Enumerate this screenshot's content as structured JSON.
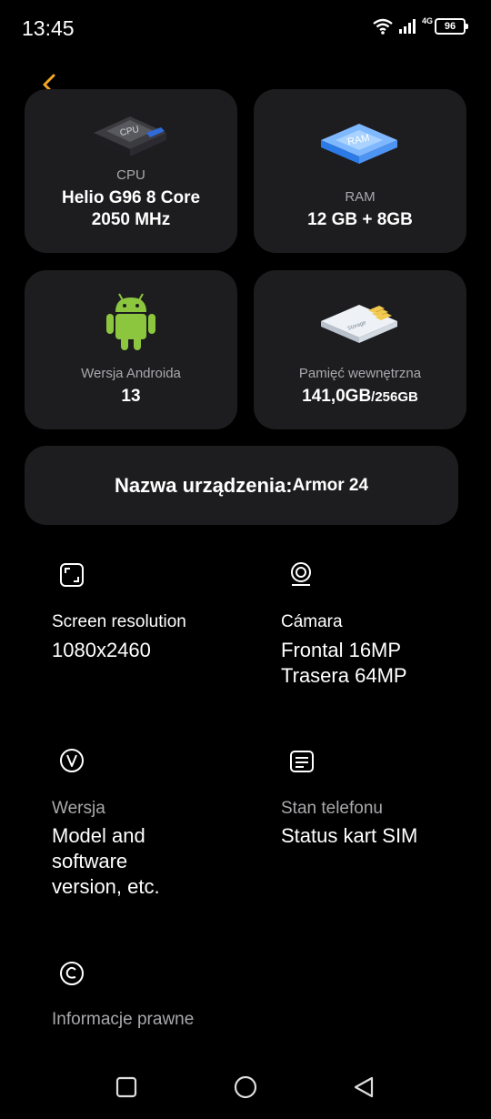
{
  "status_bar": {
    "time": "13:45",
    "network": "4G",
    "battery": "96",
    "icons": [
      "wifi-icon",
      "signal-icon",
      "battery-icon"
    ]
  },
  "header": {
    "back_icon": "chevron-left-icon",
    "accent_color": "#f5a623"
  },
  "cards": {
    "cpu": {
      "label": "CPU",
      "value_line1": "Helio G96 8 Core",
      "value_line2": "2050 MHz",
      "icon": "cpu-chip-icon"
    },
    "ram": {
      "label": "RAM",
      "value": "12 GB + 8GB",
      "icon": "ram-chip-icon"
    },
    "android": {
      "label": "Wersja Androida",
      "value": "13",
      "icon": "android-robot-icon"
    },
    "storage": {
      "label": "Pamięć wewnętrzna",
      "value_used": "141,0GB",
      "value_total": "/256GB",
      "icon": "memory-card-icon"
    }
  },
  "device": {
    "label": "Nazwa urządzenia:",
    "value": "Armor 24"
  },
  "info": {
    "screen": {
      "title": "Screen resolution",
      "value": "1080x2460",
      "icon": "screen-resolution-icon"
    },
    "camera": {
      "title": "Cámara",
      "value_line1": "Frontal 16MP",
      "value_line2": "Trasera 64MP",
      "icon": "camera-icon"
    },
    "version": {
      "title": "Wersja",
      "value_line1": "Model and",
      "value_line2": "software",
      "value_line3": "version, etc.",
      "icon": "version-icon"
    },
    "phone_status": {
      "title": "Stan telefonu",
      "value": "Status kart SIM",
      "icon": "sim-status-icon"
    },
    "legal": {
      "title": "Informacje prawne",
      "icon": "copyright-icon"
    }
  },
  "nav": {
    "icons": [
      "recents-square-icon",
      "home-circle-icon",
      "back-triangle-icon"
    ]
  }
}
